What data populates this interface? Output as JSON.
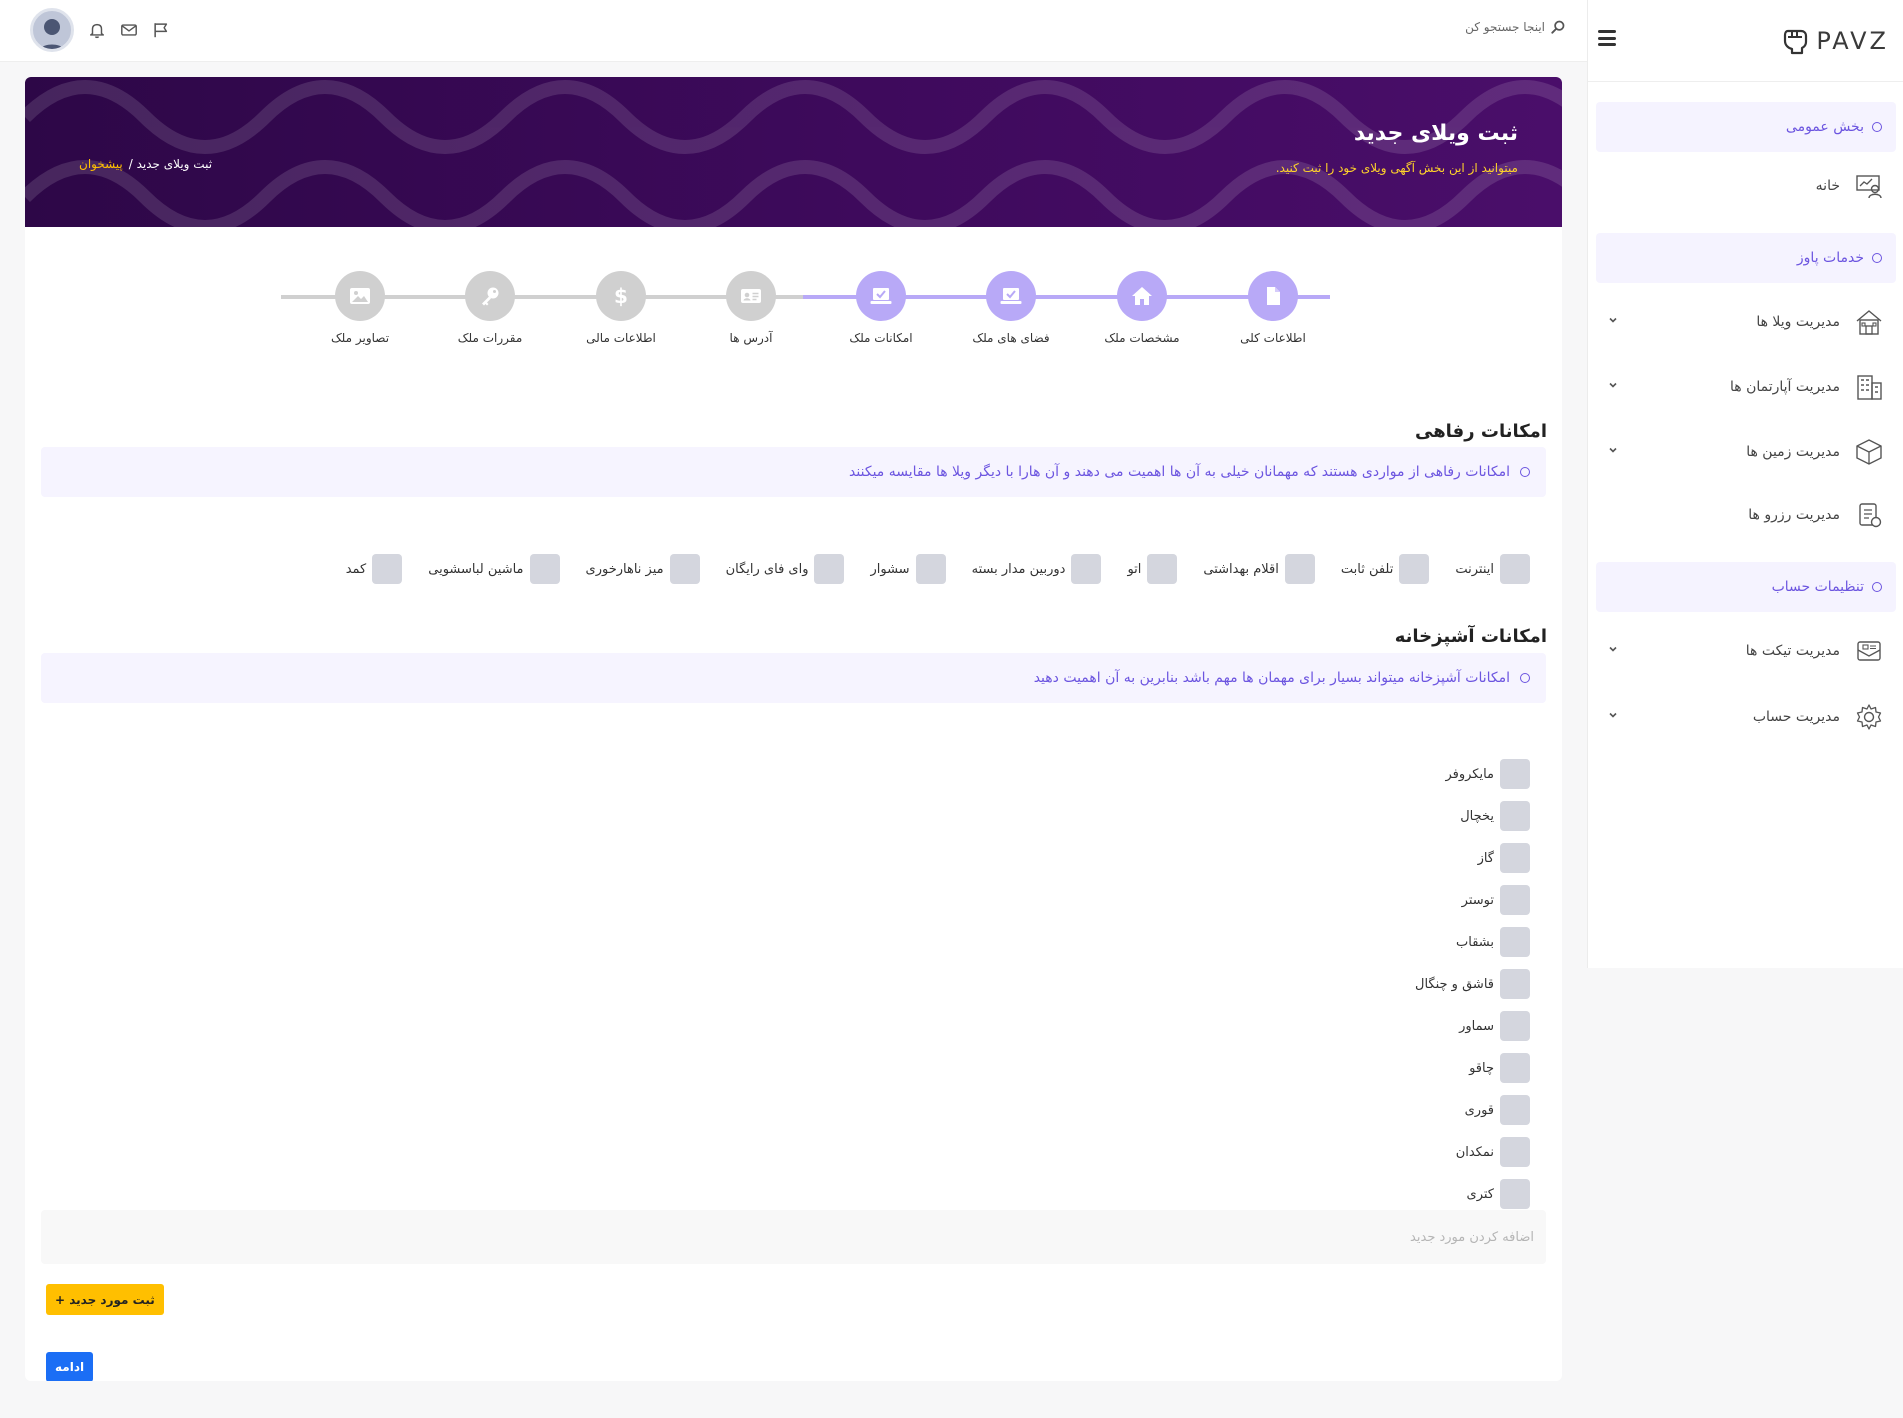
{
  "brand": {
    "logo_text": "PAVZ"
  },
  "topbar": {
    "search_placeholder": "اینجا جستجو کن"
  },
  "sidebar": {
    "section_general": "بخش عمومی",
    "home": "خانه",
    "section_services": "خدمات پاوز",
    "villas": "مدیریت ویلا ها",
    "apartments": "مدیریت آپارتمان ها",
    "lands": "مدیریت زمین ها",
    "reservations": "مدیریت رزرو ها",
    "section_account": "تنظیمات حساب",
    "tickets": "مدیریت تیکت ها",
    "account": "مدیریت حساب"
  },
  "banner": {
    "title": "ثبت ویلای جدید",
    "subtitle": "میتوانید از این بخش آگهی ویلای خود را ثبت کنید.",
    "breadcrumb_current": "ثبت ویلای جدید /",
    "breadcrumb_home": "پیشخوان"
  },
  "steps": [
    {
      "label": "اطلاعات کلی",
      "icon": "file-icon",
      "state": "done"
    },
    {
      "label": "مشخصات ملک",
      "icon": "home-icon",
      "state": "done"
    },
    {
      "label": "فضای های ملک",
      "icon": "laptop-check-icon",
      "state": "done"
    },
    {
      "label": "امکانات ملک",
      "icon": "laptop-check-icon",
      "state": "current"
    },
    {
      "label": "آدرس ها",
      "icon": "id-card-icon",
      "state": "todo"
    },
    {
      "label": "اطلاعات مالی",
      "icon": "dollar-icon",
      "state": "todo"
    },
    {
      "label": "مقررات ملک",
      "icon": "key-icon",
      "state": "todo"
    },
    {
      "label": "تصاویر ملک",
      "icon": "image-icon",
      "state": "todo"
    }
  ],
  "welfare": {
    "title": "امکانات رفاهی",
    "notice": "امکانات رفاهی از مواردی هستند که مهمانان خیلی به آن ها اهمیت می دهند و آن هارا با دیگر ویلا ها مقایسه میکنند",
    "items": [
      "اینترنت",
      "تلفن ثابت",
      "اقلام بهداشتی",
      "اتو",
      "دوربین مدار بسته",
      "سشوار",
      "وای فای رایگان",
      "میز ناهارخوری",
      "ماشین لباسشویی",
      "کمد"
    ]
  },
  "kitchen": {
    "title": "امکانات آشپزخانه",
    "notice": "امکانات آشپزخانه میتواند بسیار برای مهمان ها مهم باشد بنابرین به آن اهمیت دهید",
    "items": [
      "مایکروفر",
      "یخچال",
      "گاز",
      "توستر",
      "بشقاب",
      "قاشق و چنگال",
      "سماور",
      "چاقو",
      "قوری",
      "نمکدان",
      "کتری"
    ]
  },
  "add_new": {
    "placeholder": "اضافه کردن مورد جدید",
    "button": "ثبت مورد جدید +"
  },
  "continue_button": "ادامه",
  "colors": {
    "primary": "#6c55e0",
    "step_done": "#b8a9f7",
    "step_todo": "#d0d0d0",
    "banner": "#3a0a56",
    "warning": "#ffbf00",
    "blue": "#1b6ef5"
  }
}
